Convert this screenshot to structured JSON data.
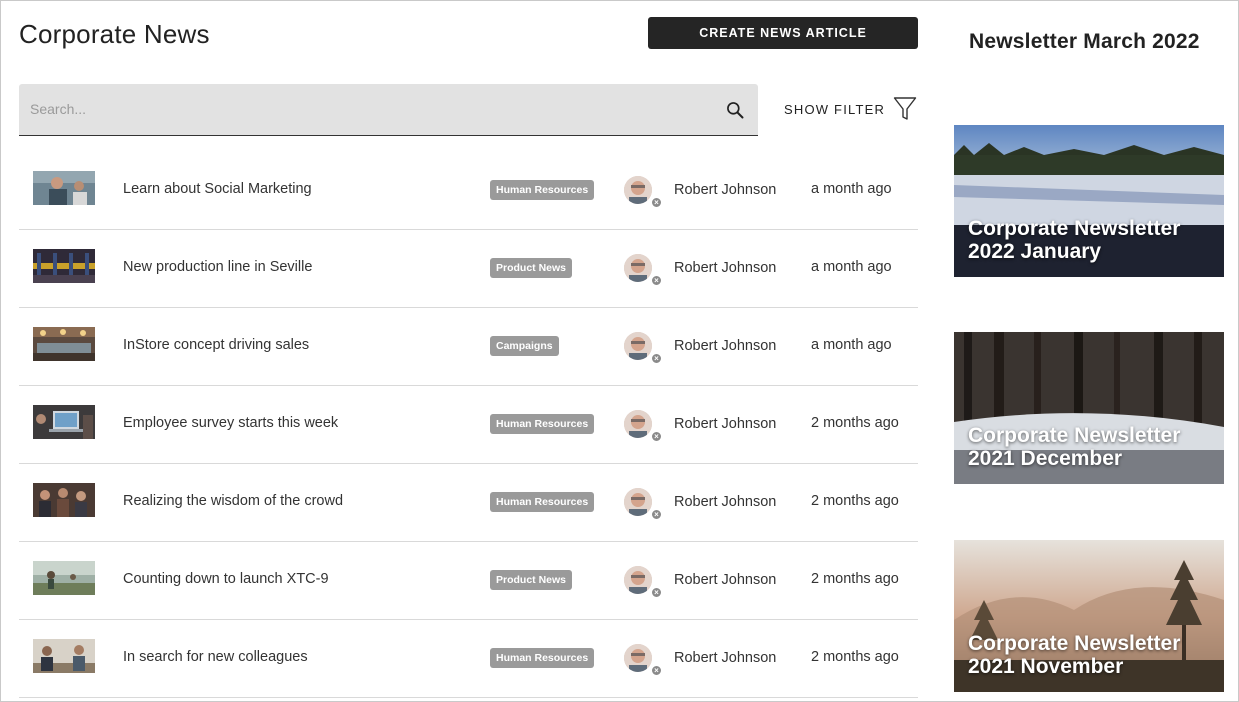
{
  "header": {
    "title": "Corporate News",
    "create_button": "CREATE NEWS ARTICLE"
  },
  "search": {
    "placeholder": "Search...",
    "value": ""
  },
  "filter": {
    "label": "SHOW FILTER"
  },
  "news": [
    {
      "title": "Learn about Social Marketing",
      "tag": "Human Resources",
      "author": "Robert Johnson",
      "time": "a month ago"
    },
    {
      "title": "New production line in Seville",
      "tag": "Product News",
      "author": "Robert Johnson",
      "time": "a month ago"
    },
    {
      "title": "InStore concept driving sales",
      "tag": "Campaigns",
      "author": "Robert Johnson",
      "time": "a month ago"
    },
    {
      "title": "Employee survey starts this week",
      "tag": "Human Resources",
      "author": "Robert Johnson",
      "time": "2 months ago"
    },
    {
      "title": "Realizing the wisdom of the crowd",
      "tag": "Human Resources",
      "author": "Robert Johnson",
      "time": "2 months ago"
    },
    {
      "title": "Counting down to launch XTC-9",
      "tag": "Product News",
      "author": "Robert Johnson",
      "time": "2 months ago"
    },
    {
      "title": "In search for new colleagues",
      "tag": "Human Resources",
      "author": "Robert Johnson",
      "time": "2 months ago"
    }
  ],
  "newsletter": {
    "heading": "Newsletter March 2022",
    "cards": [
      {
        "title": "Corporate Newsletter 2022 January"
      },
      {
        "title": "Corporate Newsletter 2021 December"
      },
      {
        "title": "Corporate Newsletter 2021 November"
      }
    ]
  },
  "colors": {
    "button_bg": "#252525",
    "search_bg": "#e2e2e2",
    "tag_bg": "#9a9a9a",
    "divider": "#d9d9d9"
  },
  "icons": {
    "search": "search-icon",
    "filter": "filter-icon",
    "presence": "presence-offline-icon"
  }
}
